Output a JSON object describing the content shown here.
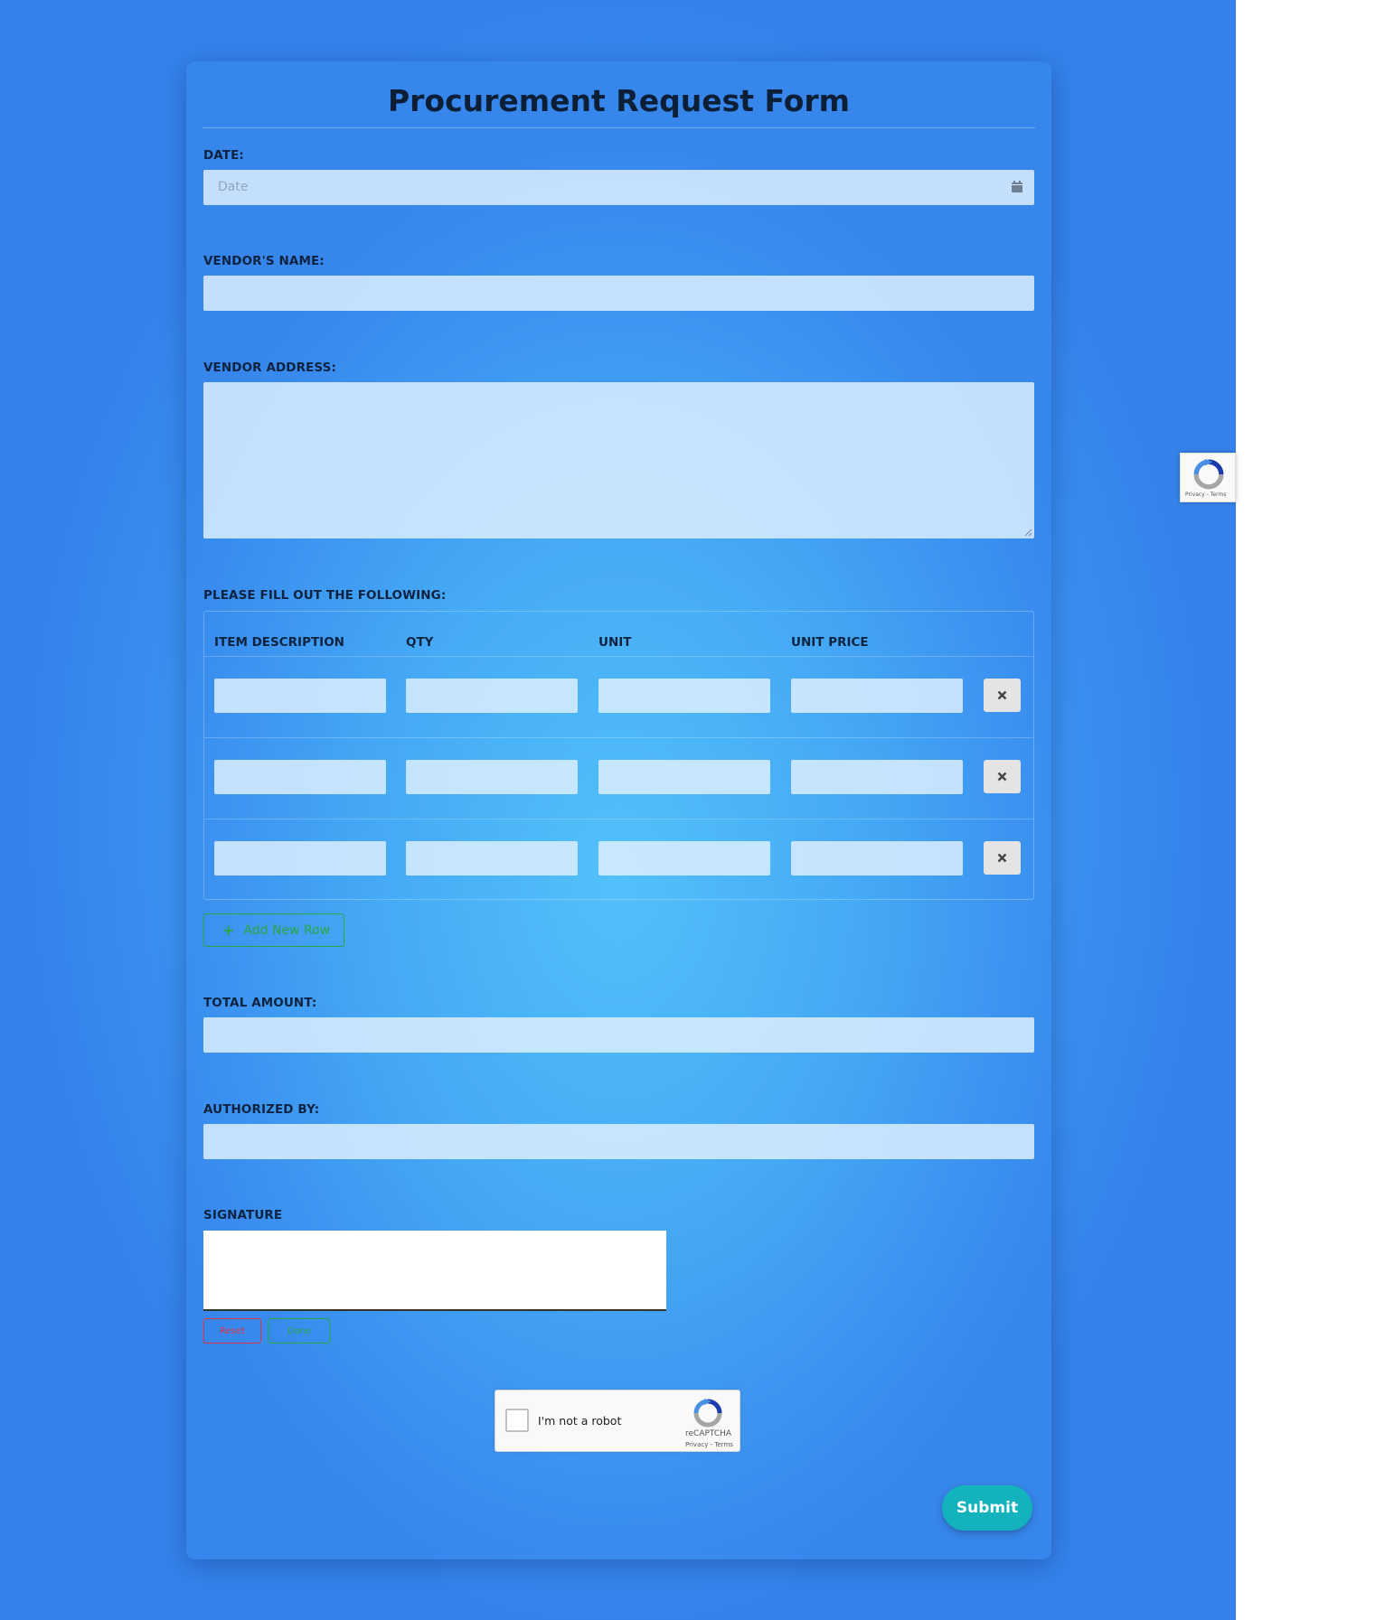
{
  "form": {
    "title": "Procurement Request Form",
    "date": {
      "label": "DATE:",
      "placeholder": "Date"
    },
    "vendor_name": {
      "label": "VENDOR'S NAME:"
    },
    "vendor_address": {
      "label": "VENDOR ADDRESS:"
    },
    "items": {
      "label": "PLEASE FILL OUT THE FOLLOWING:",
      "columns": [
        "ITEM DESCRIPTION",
        "QTY",
        "UNIT",
        "UNIT PRICE"
      ],
      "delete_icon": "times-icon",
      "add_row_label": "Add New Row",
      "add_row_icon": "plus-icon"
    },
    "total_amount": {
      "label": "TOTAL AMOUNT:"
    },
    "authorized_by": {
      "label": "AUTHORIZED BY:"
    },
    "signature": {
      "label": "SIGNATURE",
      "reset_label": "Reset",
      "done_label": "Done"
    },
    "captcha": {
      "checkbox_label": "I'm not a robot",
      "brand": "reCAPTCHA",
      "terms": "Privacy - Terms"
    },
    "submit_label": "Submit"
  },
  "recaptcha_badge": {
    "terms": "Privacy - Terms"
  },
  "colors": {
    "background": "#3a8eef",
    "submit": "#14b2bd",
    "add_row": "#28a745",
    "reset": "#dc3545"
  }
}
